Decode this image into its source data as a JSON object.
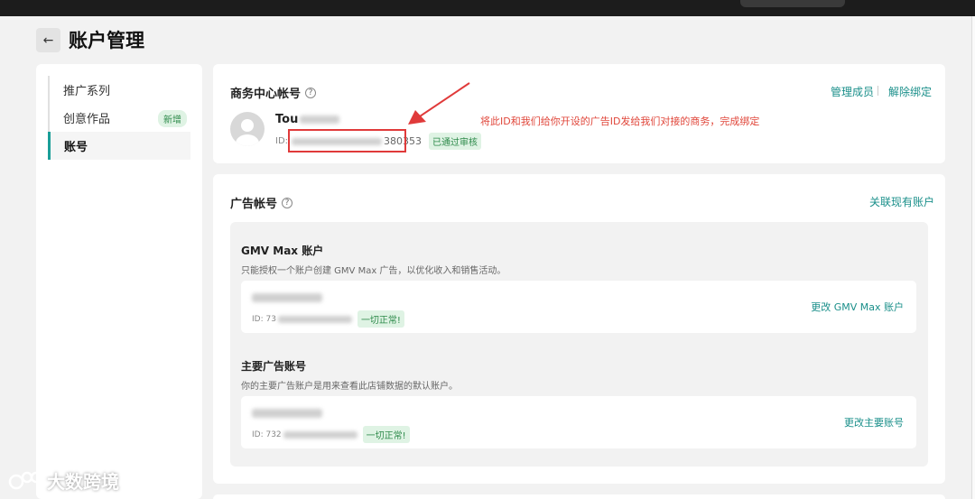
{
  "header": {
    "back_icon": "arrow-left-icon",
    "title": "账户管理"
  },
  "sidebar": {
    "items": [
      {
        "label": "推广系列"
      },
      {
        "label": "创意作品",
        "badge": "新增"
      },
      {
        "label": "账号",
        "active": true
      }
    ]
  },
  "business_center": {
    "title": "商务中心帐号",
    "manage_members": "管理成员",
    "unbind": "解除绑定",
    "account_name_prefix": "Tou",
    "id_prefix": "ID:",
    "id_suffix": "380353",
    "status": "已通过审核",
    "annotation": "将此ID和我们给你开设的广告ID发给我们对接的商务，完成绑定"
  },
  "ad_accounts": {
    "title": "广告帐号",
    "link_existing": "关联现有账户",
    "gmv": {
      "title": "GMV Max 账户",
      "desc": "只能授权一个账户创建 GMV Max 广告，以优化收入和销售活动。",
      "id_prefix": "ID: 73",
      "status": "一切正常!",
      "change": "更改 GMV Max 账户"
    },
    "primary": {
      "title": "主要广告账号",
      "desc": "你的主要广告账户是用来查看此店铺数据的默认账户。",
      "id_prefix": "ID: 732",
      "status": "一切正常!",
      "change": "更改主要账号"
    }
  },
  "watermark": {
    "text": "大数跨境"
  },
  "colors": {
    "accent": "#1a9e98",
    "link": "#1a8f8a",
    "annotation_red": "#e03a3a",
    "success_bg": "#dff3e4",
    "success_text": "#2d8a4a"
  }
}
